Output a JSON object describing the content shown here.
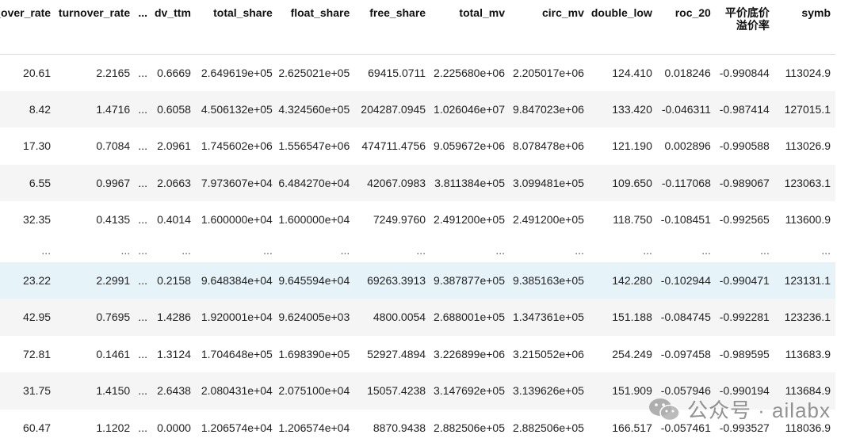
{
  "columns": [
    "b_over_rate",
    "turnover_rate",
    "...",
    "dv_ttm",
    "total_share",
    "float_share",
    "free_share",
    "total_mv",
    "circ_mv",
    "double_low",
    "roc_20",
    "平价底价\n溢价率",
    "symb"
  ],
  "rows": [
    {
      "kind": "data",
      "cells": [
        "20.61",
        "2.2165",
        "...",
        "0.6669",
        "2.649619e+05",
        "2.625021e+05",
        "69415.0711",
        "2.225680e+06",
        "2.205017e+06",
        "124.410",
        "0.018246",
        "-0.990844",
        "113024.9"
      ]
    },
    {
      "kind": "data",
      "cells": [
        "8.42",
        "1.4716",
        "...",
        "0.6058",
        "4.506132e+05",
        "4.324560e+05",
        "204287.0945",
        "1.026046e+07",
        "9.847023e+06",
        "133.420",
        "-0.046311",
        "-0.987414",
        "127015.1"
      ]
    },
    {
      "kind": "data",
      "cells": [
        "17.30",
        "0.7084",
        "...",
        "2.0961",
        "1.745602e+06",
        "1.556547e+06",
        "474711.4756",
        "9.059672e+06",
        "8.078478e+06",
        "121.190",
        "0.002896",
        "-0.990588",
        "113026.9"
      ]
    },
    {
      "kind": "data",
      "cells": [
        "6.55",
        "0.9967",
        "...",
        "2.0663",
        "7.973607e+04",
        "6.484270e+04",
        "42067.0983",
        "3.811384e+05",
        "3.099481e+05",
        "109.650",
        "-0.117068",
        "-0.989067",
        "123063.1"
      ]
    },
    {
      "kind": "data",
      "cells": [
        "32.35",
        "0.4135",
        "...",
        "0.4014",
        "1.600000e+04",
        "1.600000e+04",
        "7249.9760",
        "2.491200e+05",
        "2.491200e+05",
        "118.750",
        "-0.108451",
        "-0.992565",
        "113600.9"
      ]
    },
    {
      "kind": "ellipsis",
      "cells": [
        "...",
        "...",
        "...",
        "...",
        "...",
        "...",
        "...",
        "...",
        "...",
        "...",
        "...",
        "...",
        "..."
      ]
    },
    {
      "kind": "data",
      "cells": [
        "23.22",
        "2.2991",
        "...",
        "0.2158",
        "9.648384e+04",
        "9.645594e+04",
        "69263.3913",
        "9.387877e+05",
        "9.385163e+05",
        "142.280",
        "-0.102944",
        "-0.990471",
        "123131.1"
      ]
    },
    {
      "kind": "data",
      "cells": [
        "42.95",
        "0.7695",
        "...",
        "1.4286",
        "1.920001e+04",
        "9.624005e+03",
        "4800.0054",
        "2.688001e+05",
        "1.347361e+05",
        "151.188",
        "-0.084745",
        "-0.992281",
        "123236.1"
      ]
    },
    {
      "kind": "data",
      "cells": [
        "72.81",
        "0.1461",
        "...",
        "1.3124",
        "1.704648e+05",
        "1.698390e+05",
        "52927.4894",
        "3.226899e+06",
        "3.215052e+06",
        "254.249",
        "-0.097458",
        "-0.989595",
        "113683.9"
      ]
    },
    {
      "kind": "data",
      "cells": [
        "31.75",
        "1.4150",
        "...",
        "2.6438",
        "2.080431e+04",
        "2.075100e+04",
        "15057.4238",
        "3.147692e+05",
        "3.139626e+05",
        "151.909",
        "-0.057946",
        "-0.990194",
        "113684.9"
      ]
    },
    {
      "kind": "data",
      "cells": [
        "60.47",
        "1.1202",
        "...",
        "0.0000",
        "1.206574e+04",
        "1.206574e+04",
        "8870.9438",
        "2.882506e+05",
        "2.882506e+05",
        "166.517",
        "-0.057461",
        "-0.993527",
        "118036.9"
      ]
    }
  ],
  "watermark": {
    "text": "公众号 · ailabx",
    "icon": "wechat-icon"
  }
}
